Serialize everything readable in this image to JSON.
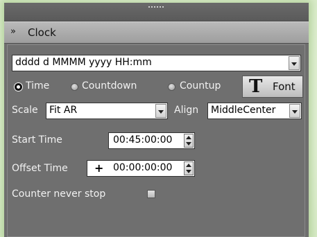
{
  "panel": {
    "title": "Clock",
    "format_value": "dddd d MMMM yyyy HH:mm",
    "mode_options": [
      {
        "label": "Time",
        "selected": true
      },
      {
        "label": "Countdown",
        "selected": false
      },
      {
        "label": "Countup",
        "selected": false
      }
    ],
    "font_button_label": "Font",
    "font_button_glyph": "T",
    "scale_label": "Scale",
    "scale_value": "Fit AR",
    "align_label": "Align",
    "align_value": "MiddleCenter",
    "start_time_label": "Start Time",
    "start_time_value": "00:45:00:00",
    "offset_time_label": "Offset Time",
    "offset_sign": "+",
    "offset_time_value": "00:00:00:00",
    "counter_never_stop_label": "Counter never stop",
    "counter_never_stop_checked": false
  },
  "icons": {
    "collapse": "chevron-double-down-icon",
    "grip": "drag-grip-icon",
    "font": "font-T-icon"
  }
}
